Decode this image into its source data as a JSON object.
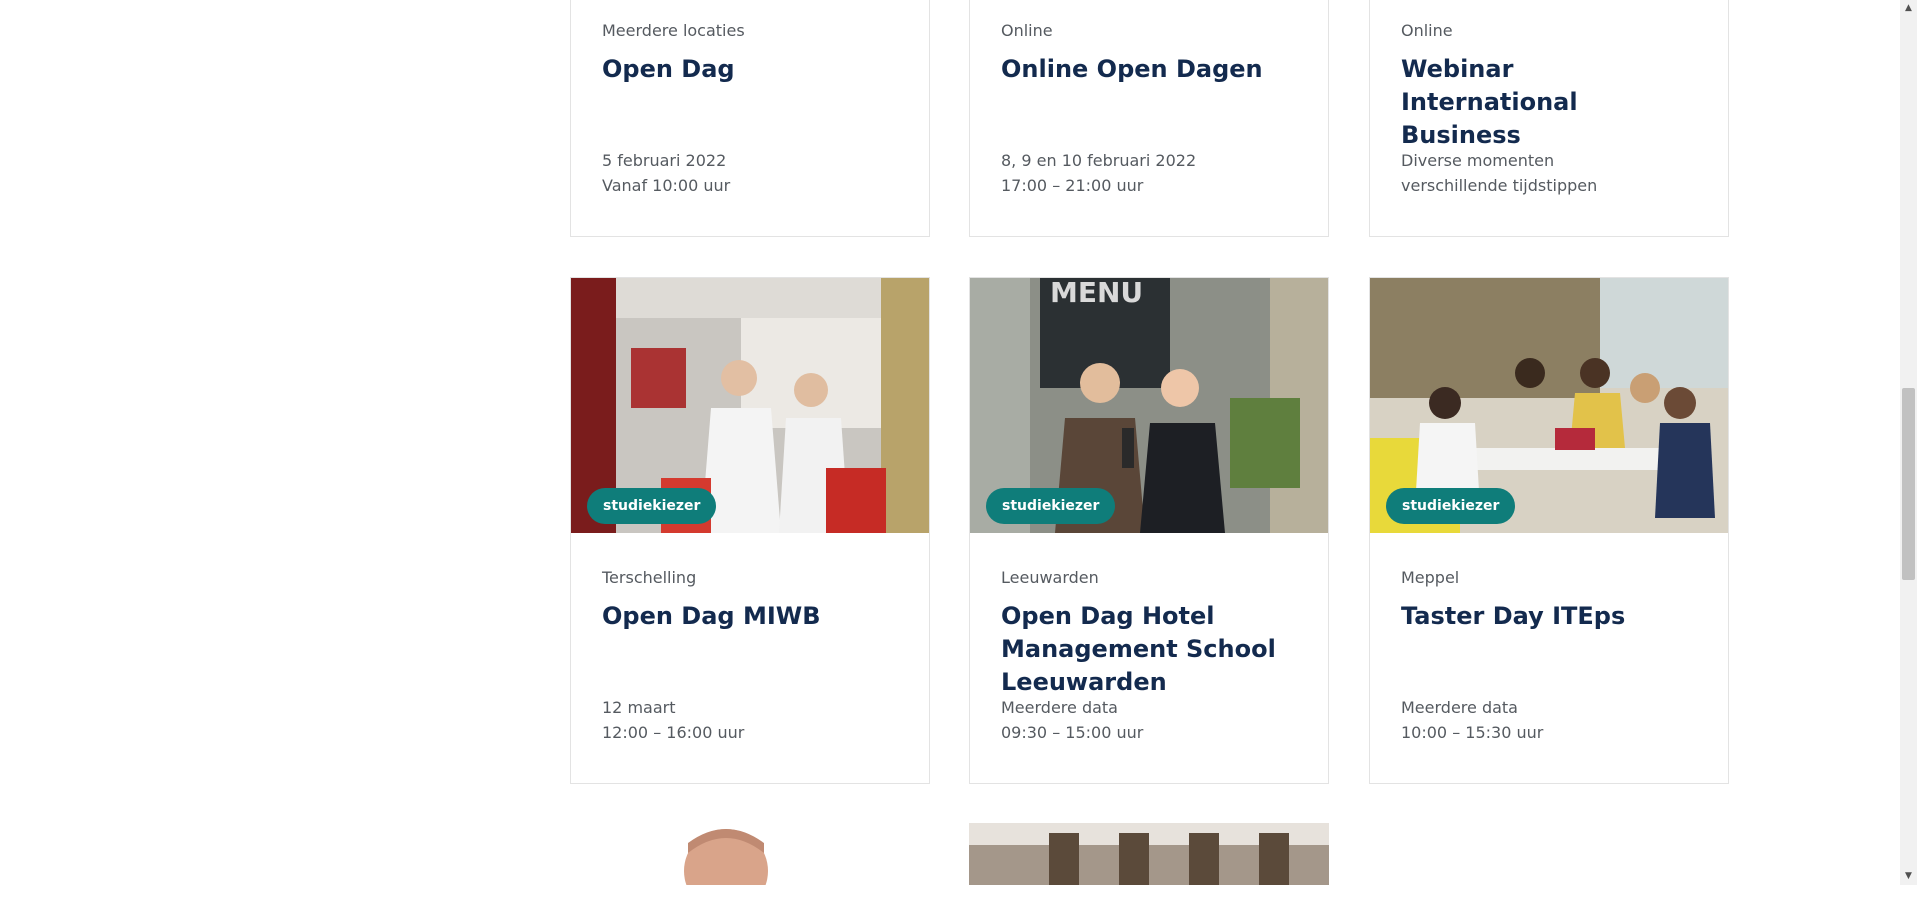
{
  "cards_top": [
    {
      "location": "Meerdere locaties",
      "title": "Open Dag",
      "date_line1": "5 februari 2022",
      "date_line2": "Vanaf 10:00 uur"
    },
    {
      "location": "Online",
      "title": "Online Open Dagen",
      "date_line1": "8, 9 en 10 februari 2022",
      "date_line2": "17:00 – 21:00 uur"
    },
    {
      "location": "Online",
      "title": "Webinar International Business",
      "date_line1": "Diverse momenten",
      "date_line2": "verschillende tijdstippen"
    }
  ],
  "cards_mid": [
    {
      "badge": "studiekiezer",
      "location": "Terschelling",
      "title": "Open Dag MIWB",
      "date_line1": "12 maart",
      "date_line2": "12:00 – 16:00 uur"
    },
    {
      "badge": "studiekiezer",
      "location": "Leeuwarden",
      "title": "Open Dag Hotel Management School Leeuwarden",
      "date_line1": "Meerdere data",
      "date_line2": "09:30 – 15:00 uur"
    },
    {
      "badge": "studiekiezer",
      "location": "Meppel",
      "title": "Taster Day ITEps",
      "date_line1": "Meerdere data",
      "date_line2": "10:00 – 15:30 uur"
    }
  ],
  "colors": {
    "badge": "#0f7d7a",
    "title": "#132a4e"
  }
}
